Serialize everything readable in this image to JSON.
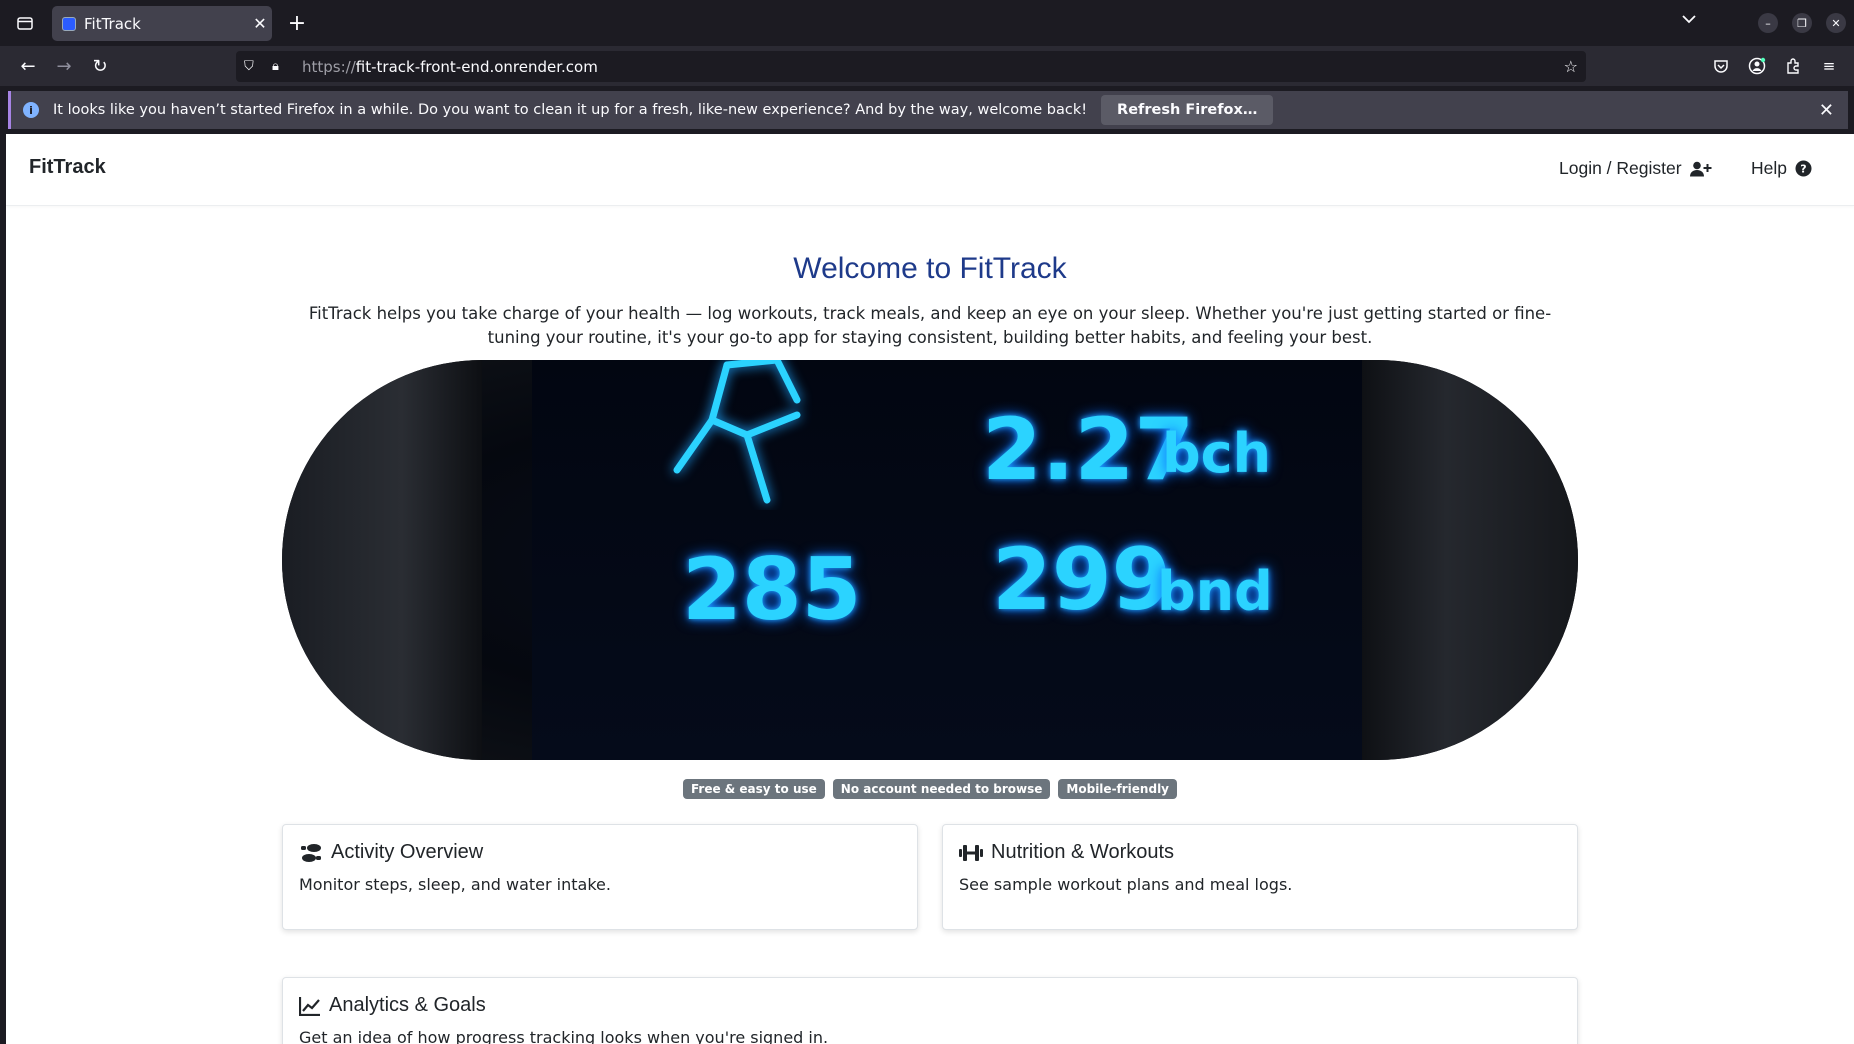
{
  "browser": {
    "tab_title": "FitTrack",
    "url_protocol": "https://",
    "url_host": "fit-track-front-end.onrender.com",
    "notification_message": "It looks like you haven’t started Firefox in a while. Do you want to clean it up for a fresh, like-new experience? And by the way, welcome back!",
    "notification_button": "Refresh Firefox…"
  },
  "site": {
    "brand": "FitTrack",
    "nav": {
      "login_label": "Login / Register",
      "help_label": "Help"
    },
    "hero": {
      "title": "Welcome to FitTrack",
      "description": "FitTrack helps you take charge of your health — log workouts, track meals, and keep an eye on your sleep. Whether you're just getting started or fine-tuning your routine, it's your go-to app for staying consistent, building better habits, and feeling your best.",
      "image_readouts": [
        "2.27",
        "bch",
        "285",
        "299",
        "bnd"
      ]
    },
    "badges": [
      "Free & easy to use",
      "No account needed to browse",
      "Mobile-friendly"
    ],
    "cards": [
      {
        "icon": "shoe-prints-icon",
        "title": "Activity Overview",
        "text": "Monitor steps, sleep, and water intake."
      },
      {
        "icon": "dumbbell-icon",
        "title": "Nutrition & Workouts",
        "text": "See sample workout plans and meal logs."
      },
      {
        "icon": "chart-line-icon",
        "title": "Analytics & Goals",
        "text": "Get an idea of how progress tracking looks when you're signed in."
      }
    ]
  },
  "colors": {
    "accent_title": "#1e3a8a",
    "badge_bg": "#6c757d",
    "glow": "#2bd3ff"
  }
}
